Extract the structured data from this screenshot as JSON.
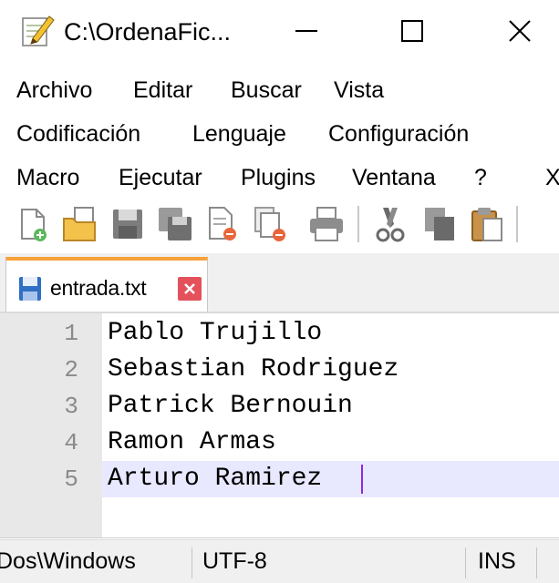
{
  "window": {
    "title": "C:\\OrdenaFic...",
    "minimize_glyph": "—",
    "maximize_glyph": "☐",
    "close_glyph": "✕"
  },
  "menu": {
    "row1": [
      "Archivo",
      "Editar",
      "Buscar",
      "Vista"
    ],
    "row2": [
      "Codificación",
      "Lenguaje",
      "Configuración"
    ],
    "row3": [
      "Macro",
      "Ejecutar",
      "Plugins",
      "Ventana",
      "?",
      "X"
    ]
  },
  "toolbar": {
    "icons": [
      "new-file-icon",
      "open-file-icon",
      "save-icon",
      "save-all-icon",
      "close-icon",
      "close-all-icon",
      "print-icon",
      "cut-icon",
      "copy-icon",
      "paste-icon"
    ]
  },
  "tabs": [
    {
      "label": "entrada.txt",
      "active": true
    }
  ],
  "editor": {
    "lines": [
      {
        "number": "1",
        "text": "Pablo Trujillo"
      },
      {
        "number": "2",
        "text": "Sebastian Rodriguez"
      },
      {
        "number": "3",
        "text": "Patrick Bernouin"
      },
      {
        "number": "4",
        "text": "Ramon Armas"
      },
      {
        "number": "5",
        "text": "Arturo Ramirez"
      }
    ],
    "current_line": "5"
  },
  "status": {
    "eol": "Dos\\Windows",
    "encoding": "UTF-8",
    "mode": "INS"
  },
  "colors": {
    "tab_accent": "#f7a23a",
    "tab_close": "#e4515a",
    "current_line": "#e8e8ff",
    "gutter": "#e8e8e8",
    "caret": "#8a2be2"
  }
}
